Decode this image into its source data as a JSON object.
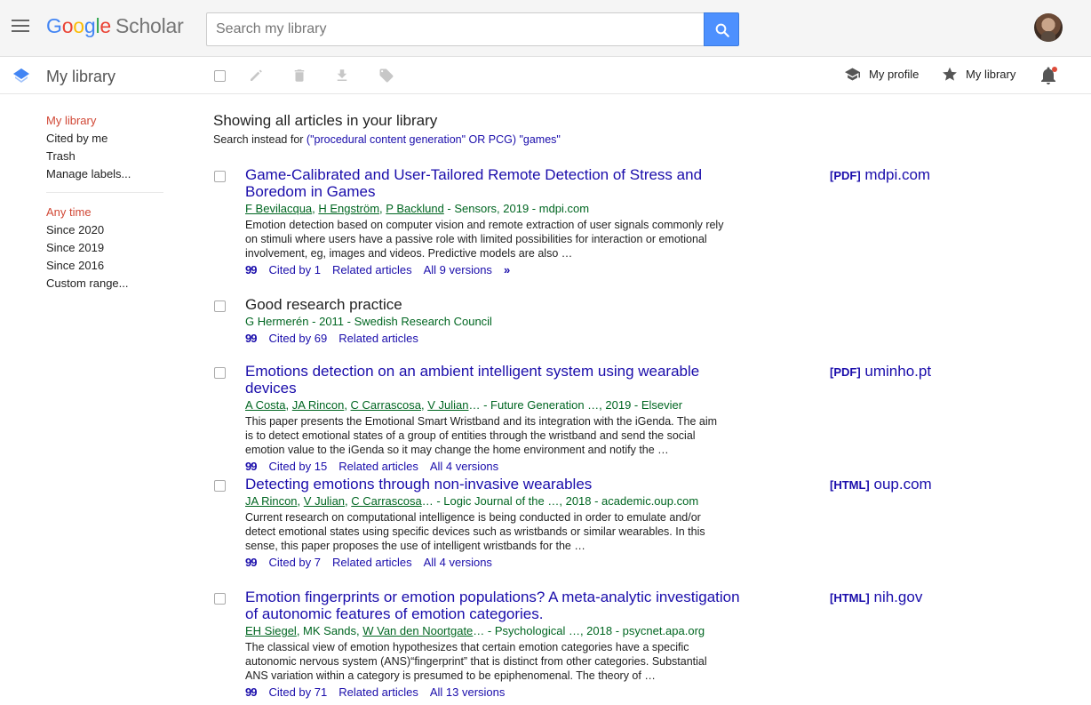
{
  "header": {
    "logo": {
      "g": "G",
      "o1": "o",
      "o2": "o",
      "g2": "g",
      "l": "l",
      "e": "e",
      "product": "Scholar"
    },
    "search": {
      "placeholder": "Search my library",
      "value": ""
    }
  },
  "subbar": {
    "title": "My library",
    "nav": {
      "profile": "My profile",
      "library": "My library"
    }
  },
  "sidebar": {
    "nav": [
      {
        "label": "My library",
        "active": true
      },
      {
        "label": "Cited by me",
        "active": false
      },
      {
        "label": "Trash",
        "active": false
      },
      {
        "label": "Manage labels...",
        "active": false
      }
    ],
    "time": [
      {
        "label": "Any time",
        "active": true
      },
      {
        "label": "Since 2020",
        "active": false
      },
      {
        "label": "Since 2019",
        "active": false
      },
      {
        "label": "Since 2016",
        "active": false
      },
      {
        "label": "Custom range...",
        "active": false
      }
    ]
  },
  "main": {
    "heading": "Showing all articles in your library",
    "search_instead_prefix": "Search instead for ",
    "search_instead_query": "(\"procedural content generation\" OR PCG) \"games\""
  },
  "results": [
    {
      "title": "Game-Calibrated and User-Tailored Remote Detection of Stress and Boredom in Games",
      "authors_linked": [
        "F Bevilacqua",
        "H Engström",
        "P Backlund"
      ],
      "authors_tail": " - Sensors, 2019 - mdpi.com",
      "snippet": "Emotion detection based on computer vision and remote extraction of user signals commonly rely on stimuli where users have a passive role with limited possibilities for interaction or emotional involvement, eg, images and videos. Predictive models are also …",
      "cited_by": "Cited by 1",
      "related": "Related articles",
      "versions": "All 9 versions",
      "side_format": "[PDF]",
      "side_domain": "mdpi.com"
    },
    {
      "title": "Good research practice",
      "authors_plain": "G Hermerén",
      "authors_tail": " - 2011 - Swedish Research Council",
      "cited_by": "Cited by 69",
      "related": "Related articles"
    },
    {
      "title": "Emotions detection on an ambient intelligent system using wearable devices",
      "authors_linked": [
        "A Costa",
        "JA Rincon",
        "C Carrascosa",
        "V Julian"
      ],
      "authors_tail": "… - Future Generation …, 2019 - Elsevier",
      "snippet": "This paper presents the Emotional Smart Wristband and its integration with the iGenda. The aim is to detect emotional states of a group of entities through the wristband and send the social emotion value to the iGenda so it may change the home environment and notify the …",
      "cited_by": "Cited by 15",
      "related": "Related articles",
      "versions": "All 4 versions",
      "side_format": "[PDF]",
      "side_domain": "uminho.pt"
    },
    {
      "title": "Detecting emotions through non-invasive wearables",
      "authors_linked": [
        "JA Rincon",
        "V Julian",
        "C Carrascosa"
      ],
      "authors_tail": "… - Logic Journal of the …, 2018 - academic.oup.com",
      "snippet": "Current research on computational intelligence is being conducted in order to emulate and/or detect emotional states using specific devices such as wristbands or similar wearables. In this sense, this paper proposes the use of intelligent wristbands for the …",
      "cited_by": "Cited by 7",
      "related": "Related articles",
      "versions": "All 4 versions",
      "side_format": "[HTML]",
      "side_domain": "oup.com"
    },
    {
      "title": "Emotion fingerprints or emotion populations? A meta-analytic investigation of autonomic features of emotion categories.",
      "authors_a": "EH Siegel",
      "authors_b": ", MK Sands, ",
      "authors_c": "W Van den Noortgate",
      "authors_tail": "… - Psychological …, 2018 - psycnet.apa.org",
      "snippet": "The classical view of emotion hypothesizes that certain emotion categories have a specific autonomic nervous system (ANS)“fingerprint” that is distinct from other categories. Substantial ANS variation within a category is presumed to be epiphenomenal. The theory of …",
      "cited_by": "Cited by 71",
      "related": "Related articles",
      "versions": "All 13 versions",
      "side_format": "[HTML]",
      "side_domain": "nih.gov"
    }
  ],
  "colors": {
    "link": "#1a0dab",
    "author_green": "#006621",
    "active_red": "#d14836",
    "search_blue": "#4d90fe"
  }
}
